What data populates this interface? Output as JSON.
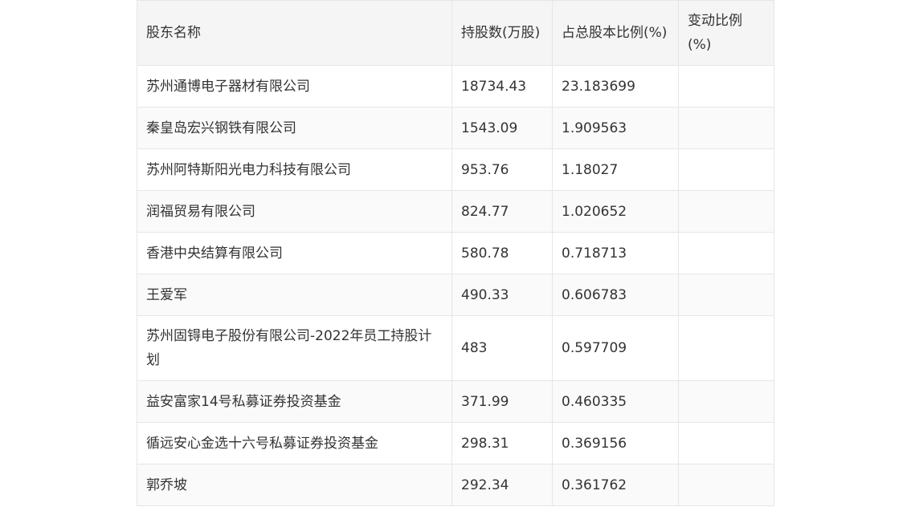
{
  "table": {
    "headers": [
      "股东名称",
      "持股数(万股)",
      "占总股本比例(%)",
      "变动比例(%)"
    ],
    "rows": [
      [
        "苏州通博电子器材有限公司",
        "18734.43",
        "23.183699",
        ""
      ],
      [
        "秦皇岛宏兴钢铁有限公司",
        "1543.09",
        "1.909563",
        ""
      ],
      [
        "苏州阿特斯阳光电力科技有限公司",
        "953.76",
        "1.18027",
        ""
      ],
      [
        "润福贸易有限公司",
        "824.77",
        "1.020652",
        ""
      ],
      [
        "香港中央结算有限公司",
        "580.78",
        "0.718713",
        ""
      ],
      [
        "王爱军",
        "490.33",
        "0.606783",
        ""
      ],
      [
        "苏州固锝电子股份有限公司-2022年员工持股计划",
        "483",
        "0.597709",
        ""
      ],
      [
        "益安富家14号私募证券投资基金",
        "371.99",
        "0.460335",
        ""
      ],
      [
        "循远安心金选十六号私募证券投资基金",
        "298.31",
        "0.369156",
        ""
      ],
      [
        "郭乔坡",
        "292.34",
        "0.361762",
        ""
      ]
    ]
  }
}
